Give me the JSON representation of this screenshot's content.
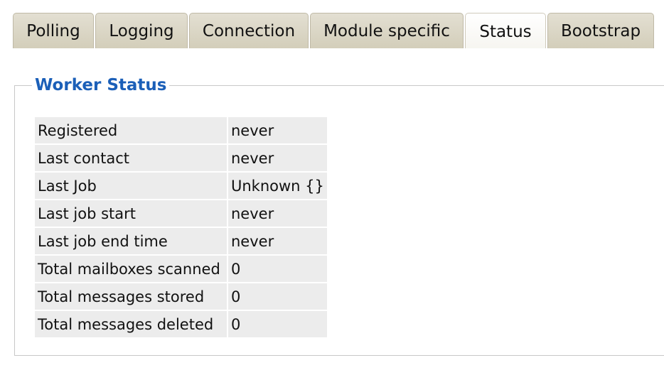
{
  "tabs": [
    {
      "label": "Polling"
    },
    {
      "label": "Logging"
    },
    {
      "label": "Connection"
    },
    {
      "label": "Module specific"
    },
    {
      "label": "Status"
    },
    {
      "label": "Bootstrap"
    }
  ],
  "active_tab": "Status",
  "worker_status": {
    "legend": "Worker Status",
    "rows": [
      {
        "label": "Registered",
        "value": "never"
      },
      {
        "label": "Last contact",
        "value": "never"
      },
      {
        "label": "Last Job",
        "value": "Unknown {}"
      },
      {
        "label": "Last job start",
        "value": "never"
      },
      {
        "label": "Last job end time",
        "value": "never"
      },
      {
        "label": "Total mailboxes scanned",
        "value": "0"
      },
      {
        "label": "Total messages stored",
        "value": "0"
      },
      {
        "label": "Total messages deleted",
        "value": "0"
      }
    ]
  },
  "colors": {
    "legend": "#1b5fb8",
    "row_bg": "#ececec",
    "tab_bg": "#d9d5c6"
  }
}
